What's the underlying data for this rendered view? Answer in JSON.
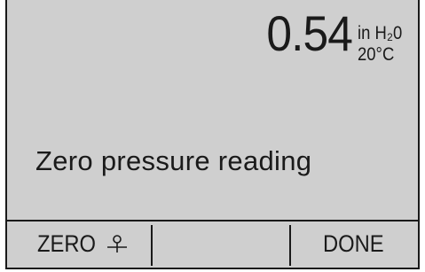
{
  "display": {
    "reading_value": "0.54",
    "unit_pressure": "in H₂0",
    "unit_temperature": "20°C"
  },
  "prompt": {
    "message": "Zero pressure reading"
  },
  "softkeys": {
    "key1_label": "ZERO",
    "key1_icon": "zero-symbol-icon",
    "key2_label": "",
    "key3_label": "DONE"
  }
}
